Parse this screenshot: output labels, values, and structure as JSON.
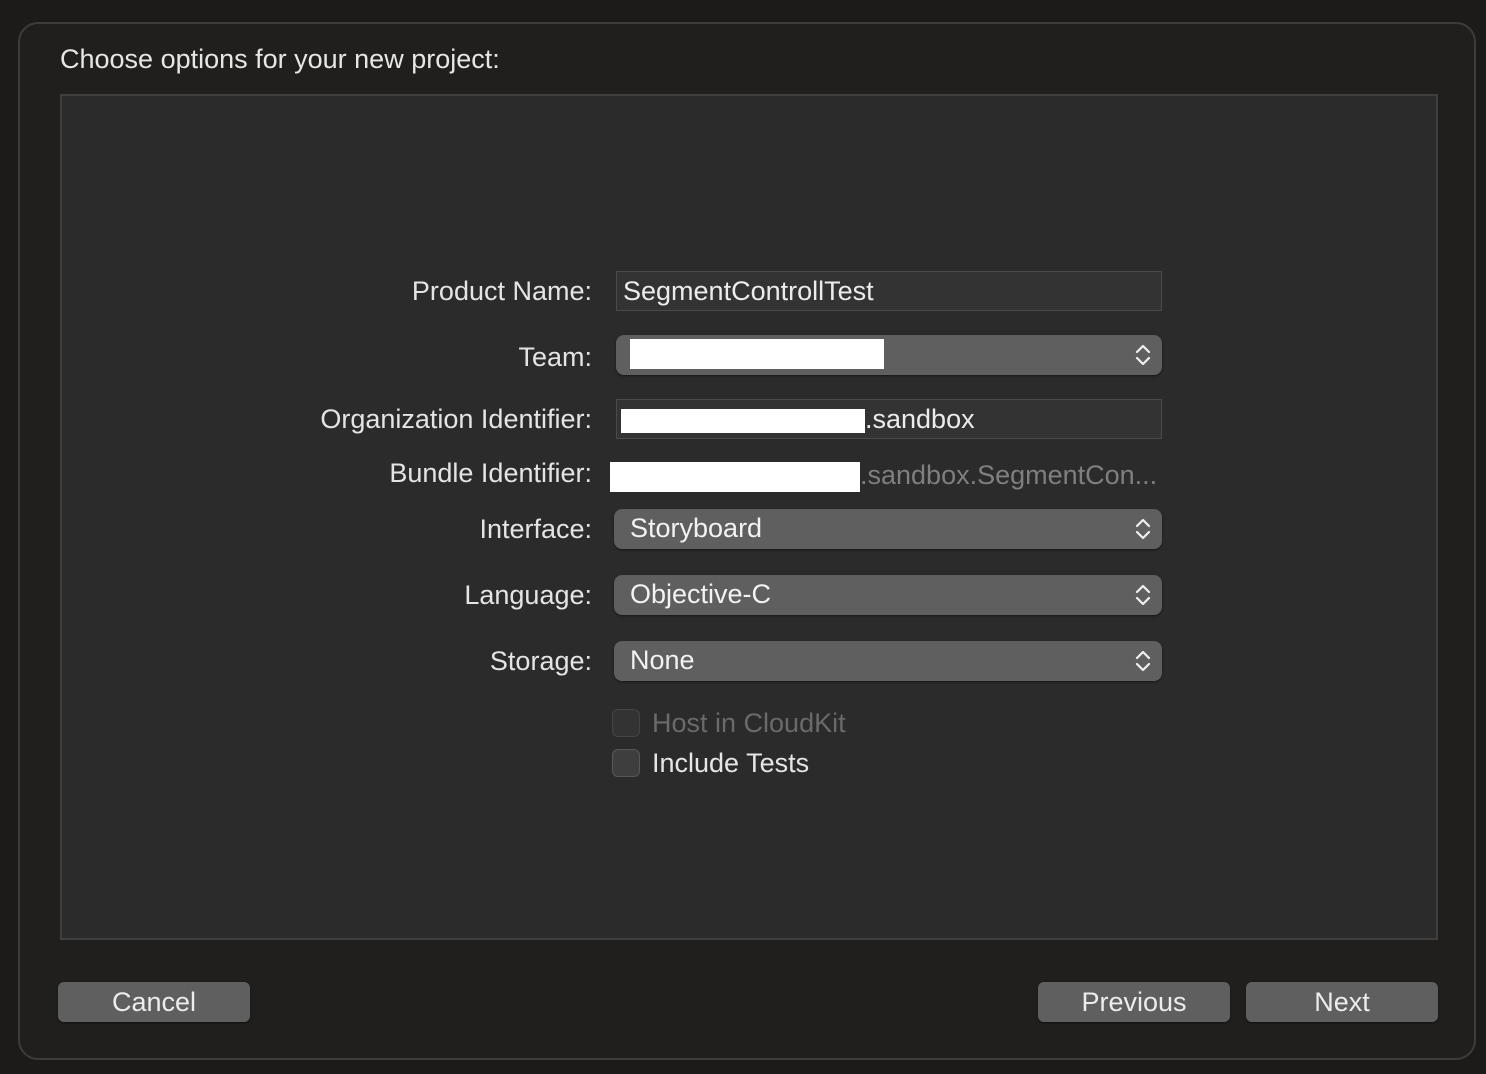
{
  "dialog": {
    "title": "Choose options for your new project:"
  },
  "form": {
    "product_name": {
      "label": "Product Name:",
      "value": "SegmentControllTest"
    },
    "team": {
      "label": "Team:",
      "value": ""
    },
    "organization_identifier": {
      "label": "Organization Identifier:",
      "value_suffix": ".sandbox"
    },
    "bundle_identifier": {
      "label": "Bundle Identifier:",
      "value_suffix": ".sandbox.SegmentCon..."
    },
    "interface": {
      "label": "Interface:",
      "value": "Storyboard"
    },
    "language": {
      "label": "Language:",
      "value": "Objective-C"
    },
    "storage": {
      "label": "Storage:",
      "value": "None"
    },
    "host_in_cloudkit": {
      "label": "Host in CloudKit",
      "checked": false,
      "enabled": false
    },
    "include_tests": {
      "label": "Include Tests",
      "checked": false,
      "enabled": true
    }
  },
  "buttons": {
    "cancel": "Cancel",
    "previous": "Previous",
    "next": "Next"
  },
  "icons": {
    "popup_indicator": "chevron-up-down-icon"
  },
  "colors": {
    "sheet_background": "#201f1d",
    "panel_background": "#2b2b2b",
    "control_background": "#5f5f5f",
    "text_primary": "#e4e4e4",
    "text_disabled": "#6a6a6a"
  }
}
